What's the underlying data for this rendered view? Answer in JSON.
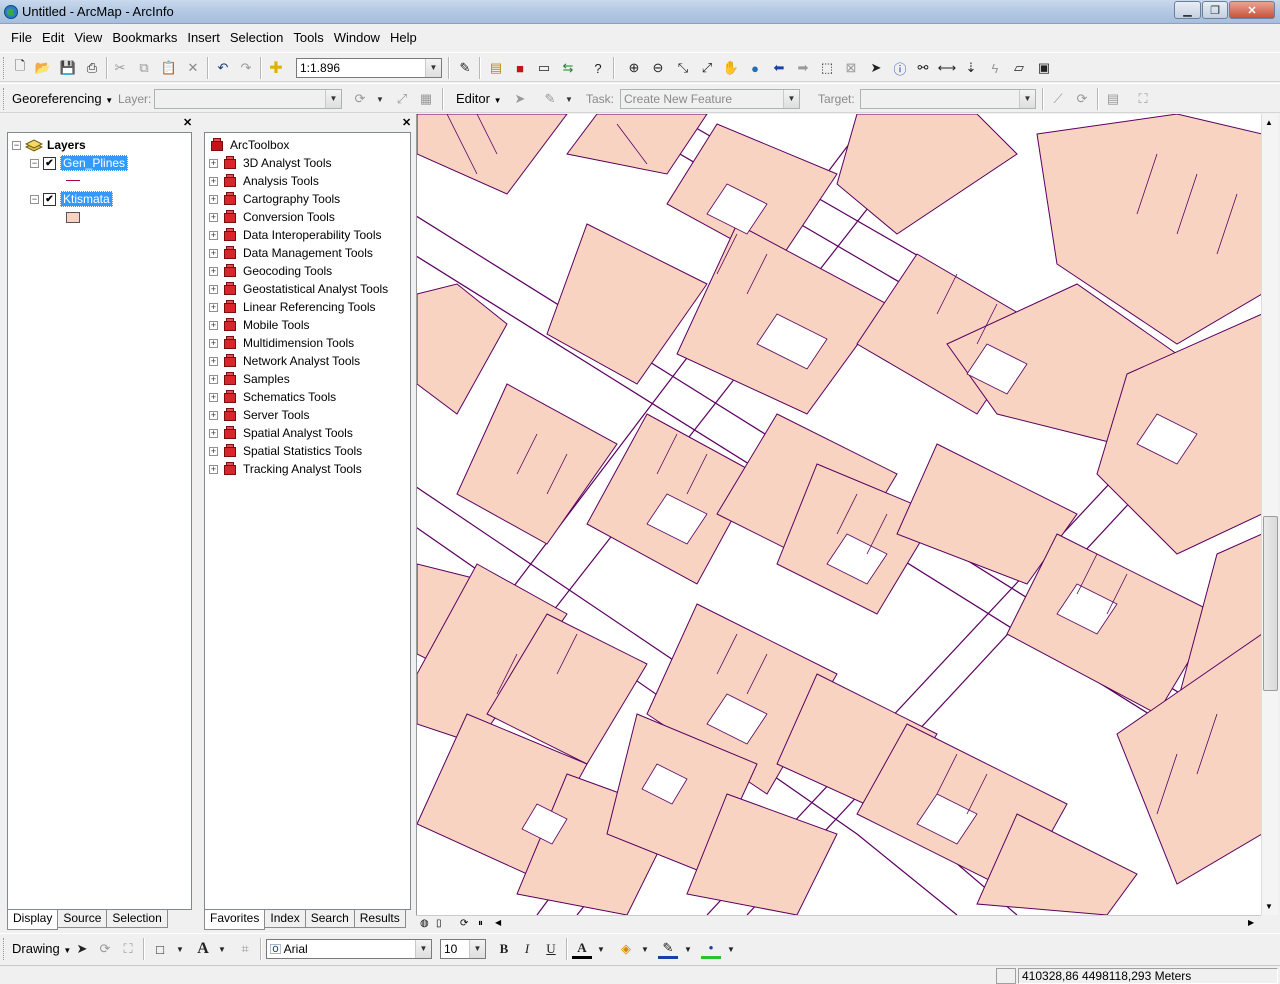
{
  "window": {
    "title": "Untitled - ArcMap - ArcInfo"
  },
  "menu": [
    "File",
    "Edit",
    "View",
    "Bookmarks",
    "Insert",
    "Selection",
    "Tools",
    "Window",
    "Help"
  ],
  "standard_toolbar": {
    "scale": "1:1.896"
  },
  "georef_toolbar": {
    "menu_label": "Georeferencing",
    "layer_label": "Layer:",
    "layer_value": ""
  },
  "editor_toolbar": {
    "menu_label": "Editor",
    "task_label": "Task:",
    "task_value": "Create New Feature",
    "target_label": "Target:",
    "target_value": ""
  },
  "toc": {
    "root": "Layers",
    "layers": [
      {
        "name": "Gen_Plines",
        "checked": true,
        "symbol": "line"
      },
      {
        "name": "Ktismata",
        "checked": true,
        "symbol": "polygon"
      }
    ],
    "tabs": [
      "Display",
      "Source",
      "Selection"
    ]
  },
  "toolbox": {
    "root": "ArcToolbox",
    "items": [
      "3D Analyst Tools",
      "Analysis Tools",
      "Cartography Tools",
      "Conversion Tools",
      "Data Interoperability Tools",
      "Data Management Tools",
      "Geocoding Tools",
      "Geostatistical Analyst Tools",
      "Linear Referencing Tools",
      "Mobile Tools",
      "Multidimension Tools",
      "Network Analyst Tools",
      "Samples",
      "Schematics Tools",
      "Server Tools",
      "Spatial Analyst Tools",
      "Spatial Statistics Tools",
      "Tracking Analyst Tools"
    ],
    "tabs": [
      "Favorites",
      "Index",
      "Search",
      "Results"
    ]
  },
  "drawing_toolbar": {
    "menu_label": "Drawing",
    "font": "Arial",
    "size": "10",
    "bold": "B",
    "italic": "I",
    "underline": "U",
    "font_color_glyph": "A"
  },
  "status": {
    "coords": "410328,86  4498118,293 Meters"
  },
  "colors": {
    "building_fill": "#f9d3c2",
    "outline": "#6a006a",
    "selection": "#3399ff"
  }
}
